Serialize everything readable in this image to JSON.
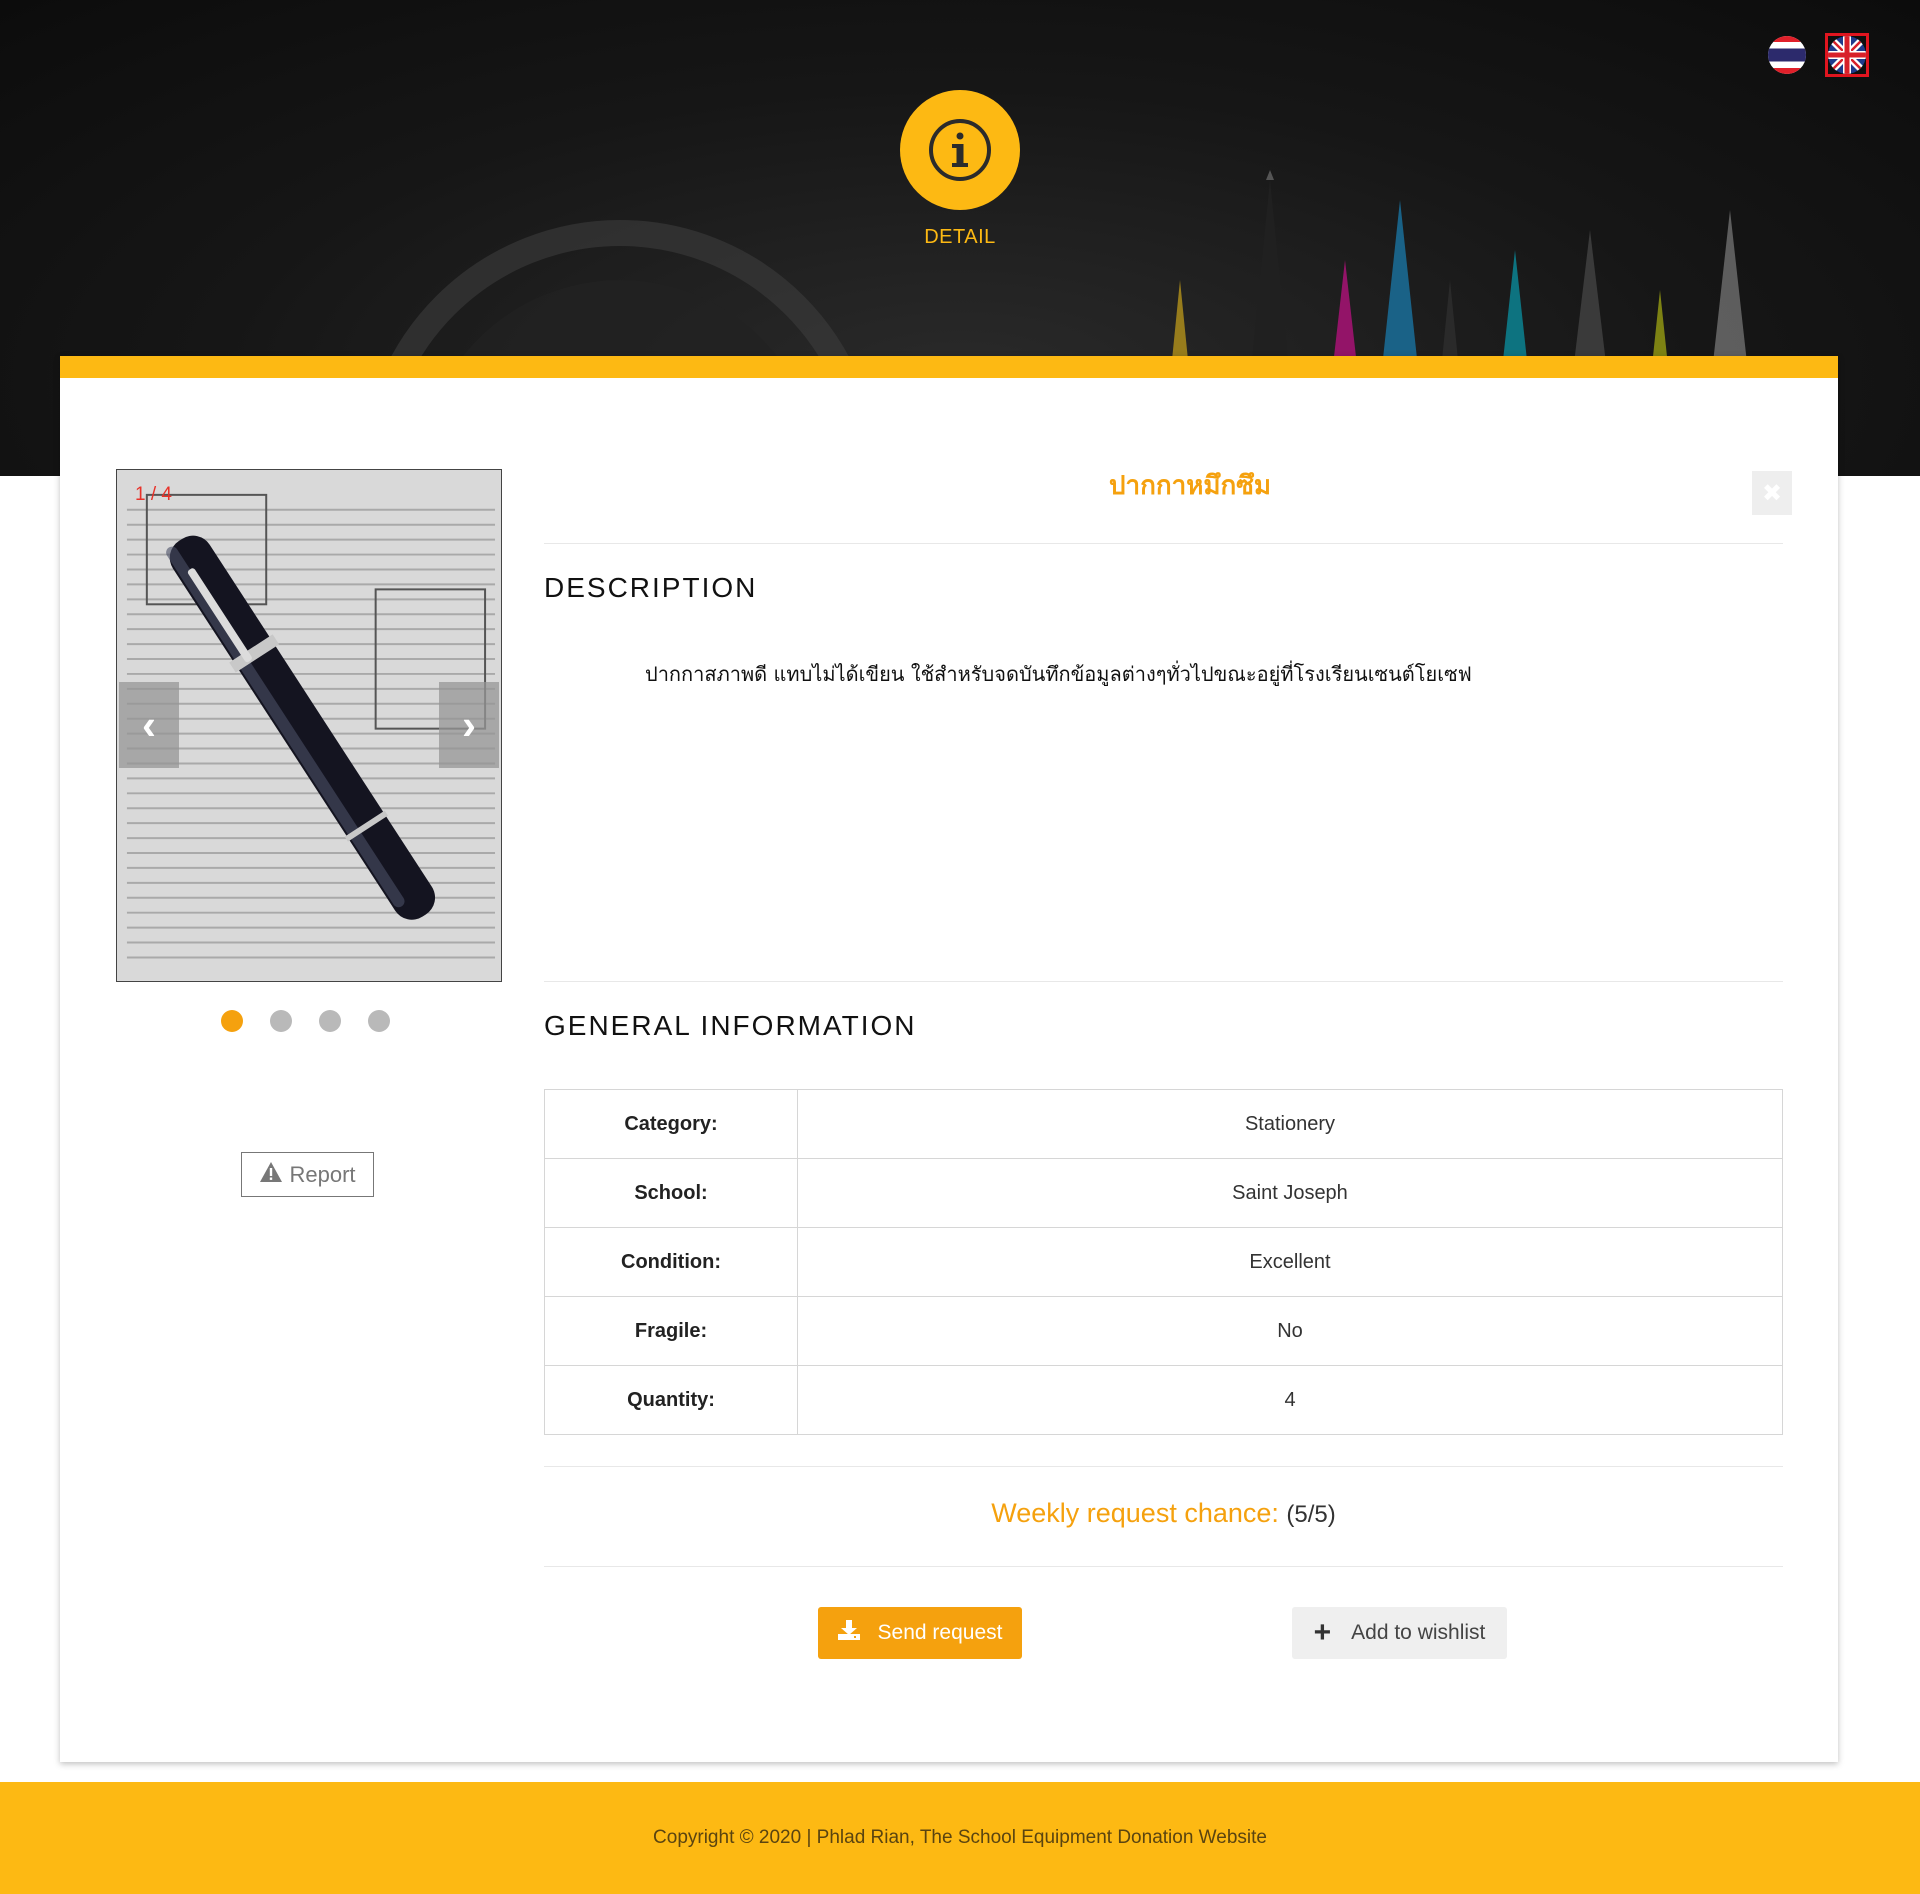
{
  "header": {
    "badge_icon": "info-icon",
    "badge_label": "DETAIL",
    "languages": [
      {
        "name": "thai-flag-icon",
        "active": false
      },
      {
        "name": "uk-flag-icon",
        "active": true
      }
    ]
  },
  "gallery": {
    "counter": "1 / 4",
    "prev_label": "‹",
    "next_label": "›",
    "total_slides": 4,
    "active_slide": 1
  },
  "report": {
    "label": "Report",
    "icon": "warning-icon"
  },
  "item": {
    "title": "ปากกาหมึกซึม",
    "description_heading": "DESCRIPTION",
    "description": "ปากกาสภาพดี แทบไม่ได้เขียน ใช้สำหรับจดบันทึกข้อมูลต่างๆทั่วไปขณะอยู่ที่โรงเรียนเซนต์โยเซฟ",
    "general_heading": "GENERAL INFORMATION",
    "info": [
      {
        "key": "Category:",
        "value": "Stationery"
      },
      {
        "key": "School:",
        "value": "Saint Joseph"
      },
      {
        "key": "Condition:",
        "value": "Excellent"
      },
      {
        "key": "Fragile:",
        "value": "No"
      },
      {
        "key": "Quantity:",
        "value": "4"
      }
    ]
  },
  "weekly": {
    "label": "Weekly request chance:",
    "value": "(5/5)"
  },
  "actions": {
    "send_label": "Send request",
    "wish_label": "Add to wishlist"
  },
  "footer": {
    "text": "Copyright © 2020 | Phlad Rian, The School Equipment Donation Website"
  },
  "colors": {
    "accent": "#fdb913",
    "orange": "#f5a10e",
    "slide_counter": "#e8322a"
  }
}
